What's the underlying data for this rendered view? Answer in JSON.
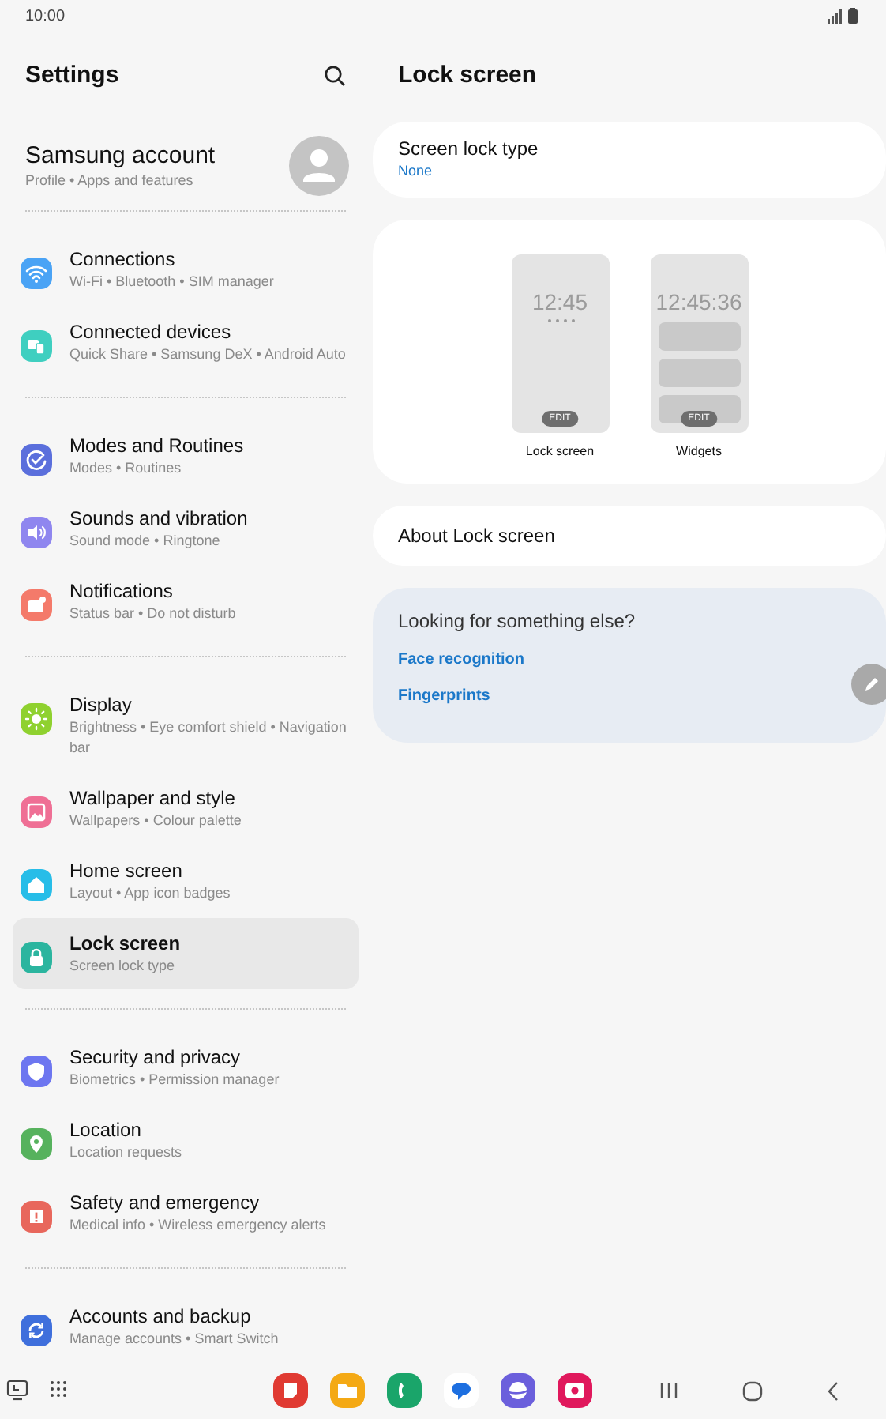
{
  "status_bar": {
    "time": "10:00"
  },
  "settings_pane": {
    "title": "Settings",
    "account": {
      "name": "Samsung account",
      "subtitle": "Profile • Apps and features"
    },
    "groups": [
      {
        "items": [
          {
            "title": "Connections",
            "subtitle": "Wi-Fi • Bluetooth • SIM manager",
            "color": "#4aa3f5",
            "selected": false
          },
          {
            "title": "Connected devices",
            "subtitle": "Quick Share • Samsung DeX • Android Auto",
            "color": "#3fcfc0",
            "selected": false
          }
        ]
      },
      {
        "items": [
          {
            "title": "Modes and Routines",
            "subtitle": "Modes • Routines",
            "color": "#5b6fdc",
            "selected": false
          },
          {
            "title": "Sounds and vibration",
            "subtitle": "Sound mode • Ringtone",
            "color": "#8f86ef",
            "selected": false
          },
          {
            "title": "Notifications",
            "subtitle": "Status bar • Do not disturb",
            "color": "#f47a6a",
            "selected": false
          }
        ]
      },
      {
        "items": [
          {
            "title": "Display",
            "subtitle": "Brightness • Eye comfort shield • Navigation bar",
            "color": "#8fd12f",
            "selected": false
          },
          {
            "title": "Wallpaper and style",
            "subtitle": "Wallpapers • Colour palette",
            "color": "#ef6f95",
            "selected": false
          },
          {
            "title": "Home screen",
            "subtitle": "Layout • App icon badges",
            "color": "#27bde8",
            "selected": false
          },
          {
            "title": "Lock screen",
            "subtitle": "Screen lock type",
            "color": "#2bb59f",
            "selected": true
          }
        ]
      },
      {
        "items": [
          {
            "title": "Security and privacy",
            "subtitle": "Biometrics • Permission manager",
            "color": "#6d76f0",
            "selected": false
          },
          {
            "title": "Location",
            "subtitle": "Location requests",
            "color": "#56b25d",
            "selected": false
          },
          {
            "title": "Safety and emergency",
            "subtitle": "Medical info • Wireless emergency alerts",
            "color": "#e8675c",
            "selected": false
          }
        ]
      },
      {
        "items": [
          {
            "title": "Accounts and backup",
            "subtitle": "Manage accounts • Smart Switch",
            "color": "#3f6fdc",
            "selected": false
          }
        ]
      }
    ]
  },
  "detail_pane": {
    "title": "Lock screen",
    "screen_lock_type": {
      "label": "Screen lock type",
      "value": "None"
    },
    "previews": [
      {
        "kind": "lock",
        "clock": "12:45",
        "edit": "EDIT",
        "label": "Lock screen"
      },
      {
        "kind": "widgets",
        "clock": "12:45:36",
        "edit": "EDIT",
        "label": "Widgets"
      }
    ],
    "about": "About Lock screen",
    "suggestions": {
      "title": "Looking for something else?",
      "links": [
        "Face recognition",
        "Fingerprints"
      ]
    }
  }
}
